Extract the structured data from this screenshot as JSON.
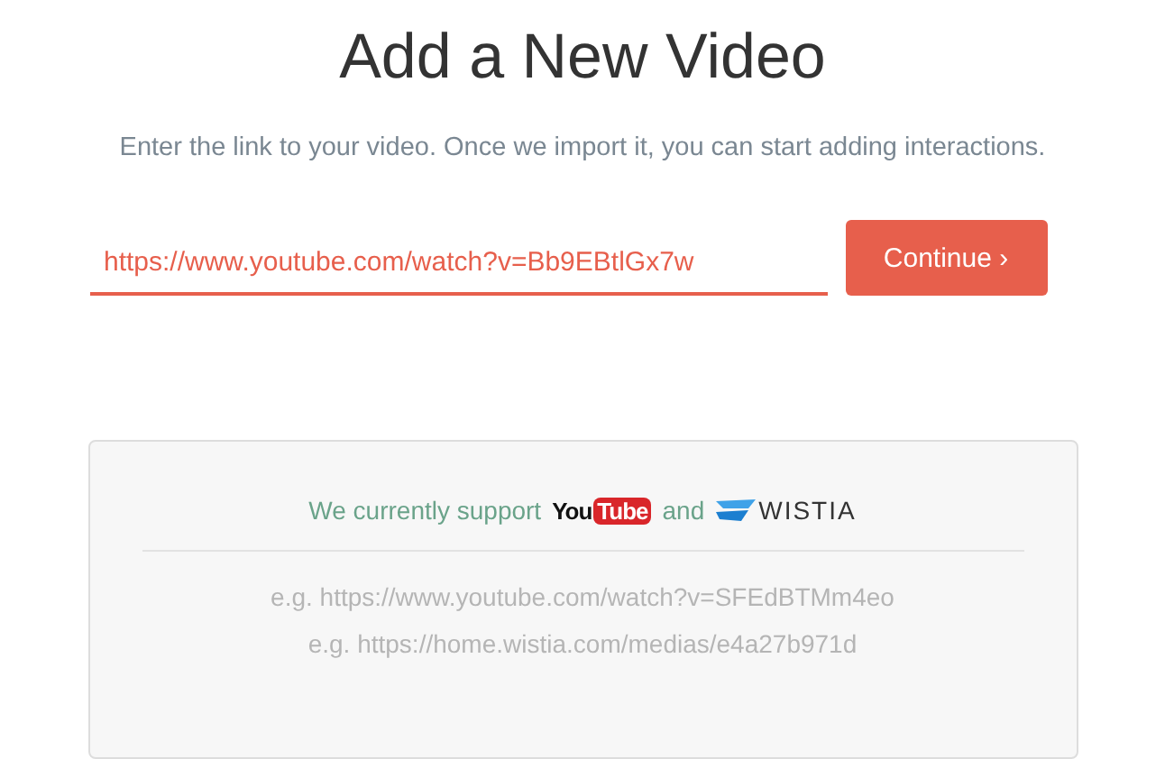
{
  "title": "Add a New Video",
  "subtitle": "Enter the link to your video. Once we import it, you can start adding interactions.",
  "url_field": {
    "value": "https://www.youtube.com/watch?v=Bb9EBtlGx7w"
  },
  "continue_button": {
    "label": "Continue ›"
  },
  "support": {
    "text": "We currently support",
    "joiner": "and",
    "logos": [
      {
        "kind": "youtube",
        "part_1": "You",
        "part_2": "Tube"
      },
      {
        "kind": "wistia",
        "part_1": "WISTIA"
      }
    ],
    "examples": [
      "e.g. https://www.youtube.com/watch?v=SFEdBTMm4eo",
      "e.g. https://home.wistia.com/medias/e4a27b971d"
    ]
  }
}
